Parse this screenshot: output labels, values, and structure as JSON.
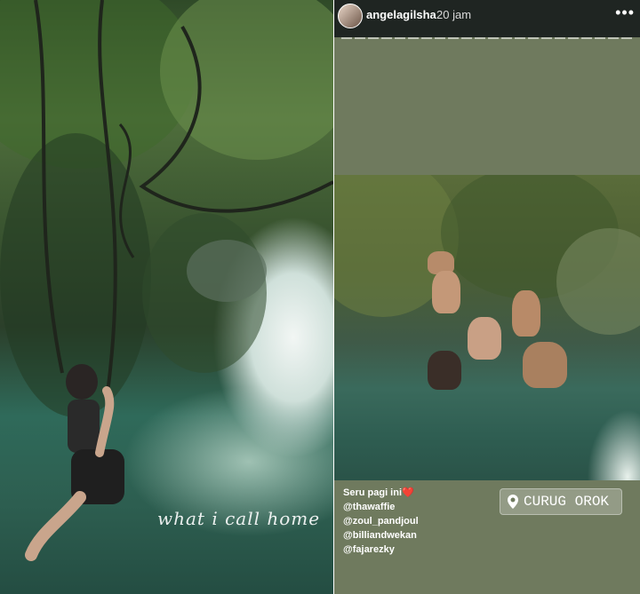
{
  "left_story": {
    "overlay_text": "what i call home"
  },
  "right_story": {
    "header": {
      "username": "angelagilsha",
      "timestamp": "20 jam",
      "more_icon": "more-icon",
      "avatar_icon": "avatar"
    },
    "caption": {
      "line1": "Seru pagi ini❤️",
      "line2": "@thawaffie",
      "line3": "@zoul_pandjoul",
      "line4": "@billiandwekan",
      "line5": "@fajarezky"
    },
    "location": {
      "icon": "location-pin-icon",
      "label": "CURUG OROK"
    }
  }
}
